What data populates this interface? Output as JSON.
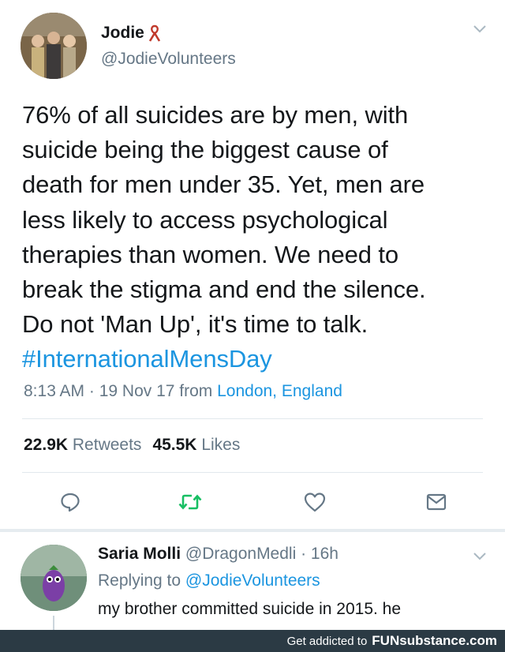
{
  "tweet": {
    "author_name": "Jodie",
    "author_handle": "@JodieVolunteers",
    "body_lines": [
      "76% of all suicides are by men, with",
      "suicide being the biggest cause of",
      "death for men under 35. Yet, men are",
      "less likely to access psychological",
      "therapies than women. We need to",
      "break the stigma and end the silence.",
      "Do not 'Man Up', it's time to talk."
    ],
    "hashtag": "#InternationalMensDay",
    "timestamp": "8:13 AM · 19 Nov 17 from ",
    "location": "London, England",
    "retweets_count": "22.9K",
    "retweets_label": "Retweets",
    "likes_count": "45.5K",
    "likes_label": "Likes",
    "icons": [
      "reply-icon",
      "retweet-icon",
      "like-icon",
      "message-icon",
      "chevron-down-icon"
    ]
  },
  "reply": {
    "author_name": "Saria Molli",
    "author_handle": "@DragonMedli",
    "time": "· 16h",
    "replying_prefix": "Replying to ",
    "replying_handle": "@JodieVolunteers",
    "text": "my brother committed suicide in 2015. he"
  },
  "footer": {
    "text": "Get addicted to",
    "brand": "FUNsubstance.com"
  },
  "colors": {
    "link": "#1b95e0",
    "secondary": "#657786",
    "retweet_green": "#17bf63",
    "footer_bg": "#2b3a44"
  }
}
